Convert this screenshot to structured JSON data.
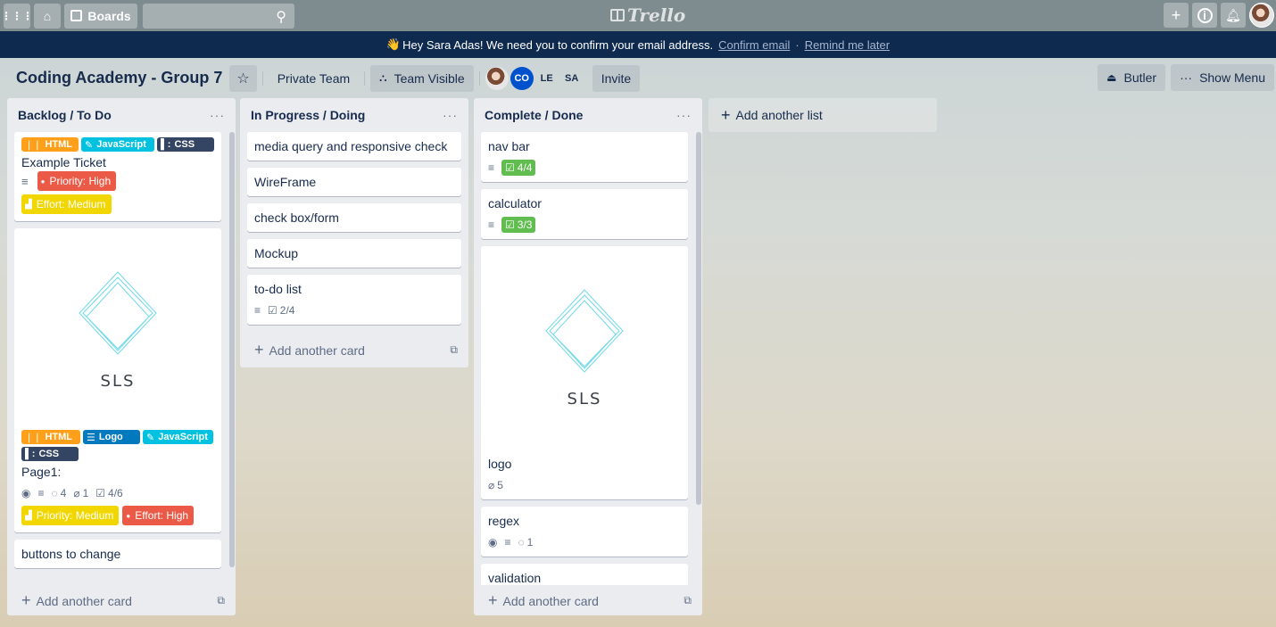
{
  "header": {
    "boards_label": "Boards",
    "logo_text": "Trello"
  },
  "banner": {
    "emoji": "👋",
    "message": "Hey Sara Adas! We need you to confirm your email address.",
    "confirm_link": "Confirm email",
    "separator": "·",
    "remind_link": "Remind me later"
  },
  "board": {
    "title": "Coding Academy - Group 7",
    "team": "Private Team",
    "visibility": "Team Visible",
    "members": [
      "CO",
      "LE",
      "SA"
    ],
    "invite": "Invite",
    "butler": "Butler",
    "show_menu": "Show Menu"
  },
  "lists": [
    {
      "title": "Backlog / To Do",
      "menu": "···",
      "cards": [
        {
          "labels": [
            "HTML",
            "JavaScript",
            "CSS"
          ],
          "title": "Example Ticket",
          "tags": [
            "Priority: High",
            "Effort: Medium"
          ]
        },
        {
          "cover_text": "SLS",
          "labels": [
            "HTML",
            "Logo",
            "JavaScript",
            "CSS"
          ],
          "title": "Page1:",
          "badges": {
            "watchers": "",
            "comments": "4",
            "attachments": "1",
            "checklist": "4/6"
          },
          "tags": [
            "Priority: Medium",
            "Effort: High"
          ]
        },
        {
          "title": "buttons to change"
        }
      ],
      "add_card": "Add another card"
    },
    {
      "title": "In Progress / Doing",
      "menu": "···",
      "cards": [
        {
          "title": "media query and responsive check"
        },
        {
          "title": "WireFrame"
        },
        {
          "title": "check box/form"
        },
        {
          "title": "Mockup"
        },
        {
          "title": "to-do list",
          "badges": {
            "checklist": "2/4"
          }
        }
      ],
      "add_card": "Add another card"
    },
    {
      "title": "Complete / Done",
      "menu": "···",
      "cards": [
        {
          "title": "nav bar",
          "badges": {
            "checklist": "4/4"
          }
        },
        {
          "title": "calculator",
          "badges": {
            "checklist": "3/3"
          }
        },
        {
          "cover_text": "SLS",
          "title": "logo",
          "badges": {
            "attachments": "5"
          }
        },
        {
          "title": "regex",
          "badges": {
            "comments": "1"
          }
        },
        {
          "title": "validation"
        }
      ],
      "add_card": "Add another card"
    }
  ],
  "add_list": "Add another list",
  "colors": {
    "topbar": "#7f8c8f",
    "banner": "#0e2a4f",
    "list_bg": "#ebecf0",
    "green": "#61bd4f",
    "orange": "#ff9f1a",
    "cyan": "#00c2e0",
    "navy": "#344563",
    "blue": "#0079bf",
    "red": "#eb5a46",
    "yellow": "#f2d600"
  },
  "icons": [
    "apps-icon",
    "home-icon",
    "boards-icon",
    "search-icon",
    "plus-icon",
    "info-icon",
    "bell-icon",
    "star-icon",
    "team-icon",
    "butler-icon",
    "more-icon",
    "description-icon",
    "checklist-icon",
    "comment-icon",
    "attachment-icon",
    "watch-icon",
    "template-icon"
  ]
}
